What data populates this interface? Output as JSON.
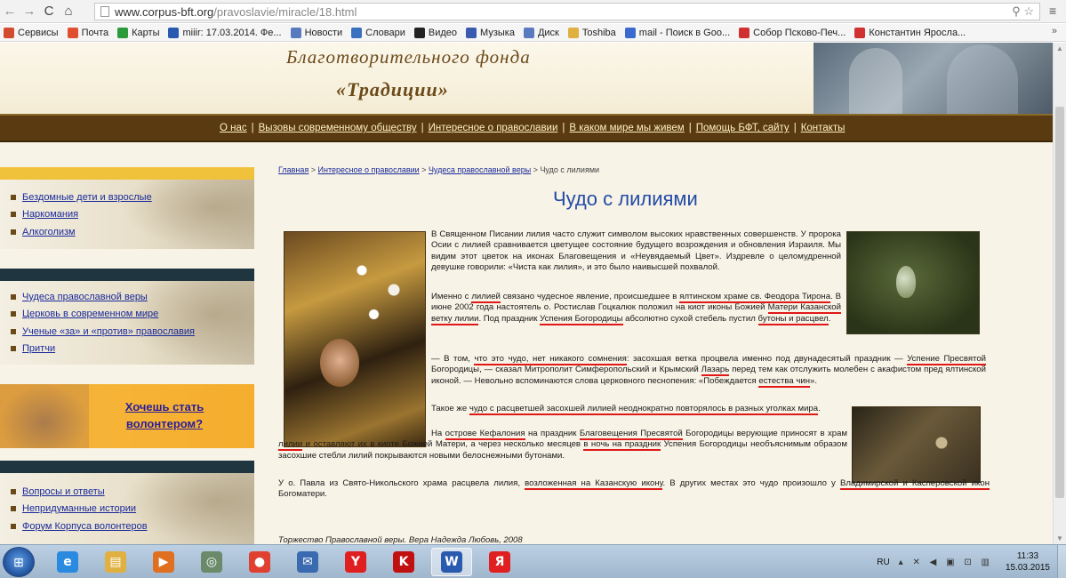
{
  "browser": {
    "url_host": "www.corpus-bft.org",
    "url_path": "/pravoslavie/miracle/18.html",
    "bookmarks": [
      {
        "label": "Сервисы",
        "color": "#d34b2e"
      },
      {
        "label": "Почта",
        "color": "#e05030"
      },
      {
        "label": "Карты",
        "color": "#2a9a3a"
      },
      {
        "label": "miiir: 17.03.2014. Фе...",
        "color": "#2a5ab0"
      },
      {
        "label": "Новости",
        "color": "#5a7ac0"
      },
      {
        "label": "Словари",
        "color": "#3a70c0"
      },
      {
        "label": "Видео",
        "color": "#222222"
      },
      {
        "label": "Музыка",
        "color": "#3a5ab0"
      },
      {
        "label": "Диск",
        "color": "#5a7ac0"
      },
      {
        "label": "Toshiba",
        "color": "#e0b040"
      },
      {
        "label": "mail - Поиск в Goo...",
        "color": "#3a6ad0"
      },
      {
        "label": "Собор Псково-Печ...",
        "color": "#d03030"
      },
      {
        "label": "Константин Яросла...",
        "color": "#d03030"
      }
    ],
    "bookmarks_more": "»"
  },
  "header": {
    "logo_line1": "Благотворительного фонда",
    "logo_line2": "«Традиции»"
  },
  "topnav": [
    "О нас",
    "Вызовы современному обществу",
    "Интересное о православии",
    "В каком мире мы живем",
    "Помощь БФТ, сайту",
    "Контакты"
  ],
  "sidebar": {
    "group1": [
      "Бездомные дети и взрослые",
      "Наркомания",
      "Алкоголизм"
    ],
    "group2": [
      "Чудеса православной веры",
      "Церковь в современном мире",
      "Ученые «за» и «против» православия",
      "Притчи"
    ],
    "volunteer_line1": "Хочешь стать",
    "volunteer_line2": "волонтером?",
    "group3": [
      "Вопросы и ответы",
      "Непридуманные истории",
      "Форум Корпуса волонтеров"
    ]
  },
  "breadcrumb": {
    "items": [
      "Главная",
      "Интересное о православии",
      "Чудеса православной веры"
    ],
    "current": "Чудо с лилиями",
    "sep": " > "
  },
  "article": {
    "title": "Чудо с лилиями",
    "p1": "В Священном Писании лилия часто служит символом высоких нравственных совершенств. У пророка Осии с лилией сравнивается цветущее состояние будущего возрождения и обновления Израиля. Мы видим этот цветок на иконах Благовещения и «Неувядаемый Цвет». Издревле о целомудренной девушке говорили: «Чиста как лилия», и это было наивысшей похвалой.",
    "p2": {
      "a": "Именно с ",
      "b": "лилией",
      "c": " связано чудесное явление, происшедшее в ",
      "d": "ялтинском храме св. Феодора Тирона",
      "e": ". В июне 2002 года настоятель о. Ростислав Гоцкалюк положил на киот иконы Божией ",
      "f": "Матери Казанской ветку лилии",
      "g": ". Под праздник ",
      "h": "Успения Богородицы",
      "i": " абсолютно сухой стебель пустил ",
      "j": "бутоны и расцвел",
      "k": "."
    },
    "p3": {
      "a": "— В том, ",
      "b": "что это чудо, нет никакого сомнения",
      "c": ": засохшая ветка процвела именно под двунадесятый праздник — ",
      "d": "Успение Пресвятой",
      "e": " Богородицы, — сказал Митрополит Симферопольский и Крымский ",
      "f": "Лазарь",
      "g": " перед тем как отслужить молебен с акафистом пред ялтинской иконой. — Невольно вспоминаются слова церковного песнопения: «Побеждается ",
      "h": "естества чин",
      "i": "»."
    },
    "p4": {
      "a": "Такое же ",
      "b": "чудо с расцветшей засохшей лилией неоднократно повторялось в разных уголках мира",
      "c": "."
    },
    "p5": {
      "a": "На ",
      "b": "острове Кефалония",
      "c": " на праздник ",
      "d": "Благовещения Пресвятой",
      "e": " Богородицы верующие приносят в храм ",
      "f": "лилии",
      "g": " и оставляют их в киоте Божией Матери, а через несколько месяцев ",
      "h": "в ночь на праздник",
      "i": " Успения Богородицы необъяснимым образом засохшие стебли лилий покрываются новыми белоснежными бутонами."
    },
    "p6": {
      "a": "У о. Павла из Свято-Никольского храма расцвела лилия, ",
      "b": "возложенная на Казанскую икону",
      "c": ". В других местах это чудо произошло у ",
      "d": "Владимирской и Касперовской икон",
      "e": " Богоматери."
    },
    "caption": "Торжество Православной веры. Вера Надежда Любовь, 2008"
  },
  "taskbar": {
    "items": [
      {
        "name": "ie",
        "glyph": "e",
        "color": "#2a8ae0"
      },
      {
        "name": "explorer",
        "glyph": "▤",
        "color": "#e0b040"
      },
      {
        "name": "media-player",
        "glyph": "▶",
        "color": "#e07020"
      },
      {
        "name": "app-circle",
        "glyph": "◎",
        "color": "#6a8a6a"
      },
      {
        "name": "chrome",
        "glyph": "●",
        "color": "#e04030"
      },
      {
        "name": "mail",
        "glyph": "✉",
        "color": "#3a6ab0"
      },
      {
        "name": "yandex-browser",
        "glyph": "Y",
        "color": "#e02020"
      },
      {
        "name": "kaspersky",
        "glyph": "K",
        "color": "#c01010"
      },
      {
        "name": "word",
        "glyph": "W",
        "color": "#2a5ab0"
      },
      {
        "name": "yandex",
        "glyph": "Я",
        "color": "#e02020"
      }
    ],
    "lang": "RU",
    "time": "11:33",
    "date": "15.03.2015"
  }
}
